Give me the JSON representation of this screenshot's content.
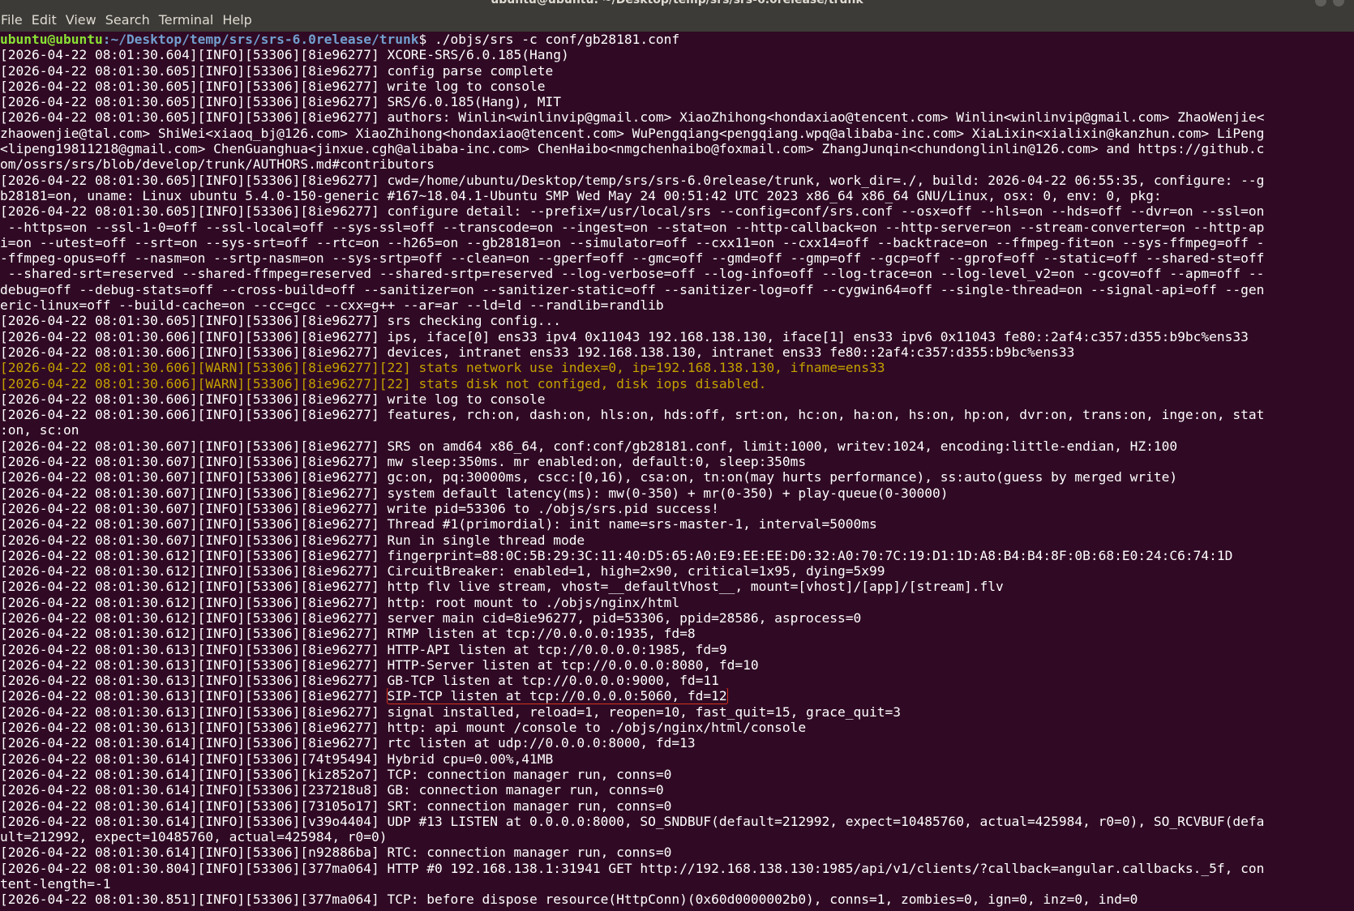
{
  "window": {
    "title": "ubuntu@ubuntu: ~/Desktop/temp/srs/srs-6.0release/trunk"
  },
  "menu": [
    "File",
    "Edit",
    "View",
    "Search",
    "Terminal",
    "Help"
  ],
  "terminal": {
    "prompt_user": "ubuntu@ubuntu",
    "prompt_path": ":~/Desktop/temp/srs/srs-6.0release/trunk",
    "command": "$ ./objs/srs -c conf/gb28181.conf",
    "highlight_text": "SIP-TCP listen at tcp://0.0.0.0:5060, fd=12",
    "colors": {
      "bg": "#300a24",
      "text": "#ffffff",
      "warn": "#c4a000",
      "user": "#8ae234",
      "path": "#729fcf",
      "highlight_box": "#d8321c"
    },
    "lines": [
      {
        "text": "[2026-04-22 08:01:30.604][INFO][53306][8ie96277] XCORE-SRS/6.0.185(Hang)"
      },
      {
        "text": "[2026-04-22 08:01:30.605][INFO][53306][8ie96277] config parse complete"
      },
      {
        "text": "[2026-04-22 08:01:30.605][INFO][53306][8ie96277] write log to console"
      },
      {
        "text": "[2026-04-22 08:01:30.605][INFO][53306][8ie96277] SRS/6.0.185(Hang), MIT"
      },
      {
        "text": "[2026-04-22 08:01:30.605][INFO][53306][8ie96277] authors: Winlin<winlinvip@gmail.com> XiaoZhihong<hondaxiao@tencent.com> Winlin<winlinvip@gmail.com> ZhaoWenjie<"
      },
      {
        "text": "zhaowenjie@tal.com> ShiWei<xiaoq_bj@126.com> XiaoZhihong<hondaxiao@tencent.com> WuPengqiang<pengqiang.wpq@alibaba-inc.com> XiaLixin<xialixin@kanzhun.com> LiPeng"
      },
      {
        "text": "<lipeng19811218@gmail.com> ChenGuanghua<jinxue.cgh@alibaba-inc.com> ChenHaibo<nmgchenhaibo@foxmail.com> ZhangJunqin<chundonglinlin@126.com> and https://github.c"
      },
      {
        "text": "om/ossrs/srs/blob/develop/trunk/AUTHORS.md#contributors"
      },
      {
        "text": "[2026-04-22 08:01:30.605][INFO][53306][8ie96277] cwd=/home/ubuntu/Desktop/temp/srs/srs-6.0release/trunk, work_dir=./, build: 2026-04-22 06:55:35, configure: --g"
      },
      {
        "text": "b28181=on, uname: Linux ubuntu 5.4.0-150-generic #167~18.04.1-Ubuntu SMP Wed May 24 00:51:42 UTC 2023 x86_64 x86_64 GNU/Linux, osx: 0, env: 0, pkg:"
      },
      {
        "text": "[2026-04-22 08:01:30.605][INFO][53306][8ie96277] configure detail: --prefix=/usr/local/srs --config=conf/srs.conf --osx=off --hls=on --hds=off --dvr=on --ssl=on"
      },
      {
        "text": " --https=on --ssl-1-0=off --ssl-local=off --sys-ssl=off --transcode=on --ingest=on --stat=on --http-callback=on --http-server=on --stream-converter=on --http-ap"
      },
      {
        "text": "i=on --utest=off --srt=on --sys-srt=off --rtc=on --h265=on --gb28181=on --simulator=off --cxx11=on --cxx14=off --backtrace=on --ffmpeg-fit=on --sys-ffmpeg=off -"
      },
      {
        "text": "-ffmpeg-opus=off --nasm=on --srtp-nasm=on --sys-srtp=off --clean=on --gperf=off --gmc=off --gmd=off --gmp=off --gcp=off --gprof=off --static=off --shared-st=off"
      },
      {
        "text": " --shared-srt=reserved --shared-ffmpeg=reserved --shared-srtp=reserved --log-verbose=off --log-info=off --log-trace=on --log-level_v2=on --gcov=off --apm=off --"
      },
      {
        "text": "debug=off --debug-stats=off --cross-build=off --sanitizer=on --sanitizer-static=off --sanitizer-log=off --cygwin64=off --single-thread=on --signal-api=off --gen"
      },
      {
        "text": "eric-linux=off --build-cache=on --cc=gcc --cxx=g++ --ar=ar --ld=ld --randlib=randlib"
      },
      {
        "text": "[2026-04-22 08:01:30.605][INFO][53306][8ie96277] srs checking config..."
      },
      {
        "text": "[2026-04-22 08:01:30.606][INFO][53306][8ie96277] ips, iface[0] ens33 ipv4 0x11043 192.168.138.130, iface[1] ens33 ipv6 0x11043 fe80::2af4:c357:d355:b9bc%ens33"
      },
      {
        "text": "[2026-04-22 08:01:30.606][INFO][53306][8ie96277] devices, intranet ens33 192.168.138.130, intranet ens33 fe80::2af4:c357:d355:b9bc%ens33"
      },
      {
        "text": "[2026-04-22 08:01:30.606][WARN][53306][8ie96277][22] stats network use index=0, ip=192.168.138.130, ifname=ens33",
        "warn": true
      },
      {
        "text": "[2026-04-22 08:01:30.606][WARN][53306][8ie96277][22] stats disk not configed, disk iops disabled.",
        "warn": true
      },
      {
        "text": "[2026-04-22 08:01:30.606][INFO][53306][8ie96277] write log to console"
      },
      {
        "text": "[2026-04-22 08:01:30.606][INFO][53306][8ie96277] features, rch:on, dash:on, hls:on, hds:off, srt:on, hc:on, ha:on, hs:on, hp:on, dvr:on, trans:on, inge:on, stat"
      },
      {
        "text": ":on, sc:on"
      },
      {
        "text": "[2026-04-22 08:01:30.607][INFO][53306][8ie96277] SRS on amd64 x86_64, conf:conf/gb28181.conf, limit:1000, writev:1024, encoding:little-endian, HZ:100"
      },
      {
        "text": "[2026-04-22 08:01:30.607][INFO][53306][8ie96277] mw sleep:350ms. mr enabled:on, default:0, sleep:350ms"
      },
      {
        "text": "[2026-04-22 08:01:30.607][INFO][53306][8ie96277] gc:on, pq:30000ms, cscc:[0,16), csa:on, tn:on(may hurts performance), ss:auto(guess by merged write)"
      },
      {
        "text": "[2026-04-22 08:01:30.607][INFO][53306][8ie96277] system default latency(ms): mw(0-350) + mr(0-350) + play-queue(0-30000)"
      },
      {
        "text": "[2026-04-22 08:01:30.607][INFO][53306][8ie96277] write pid=53306 to ./objs/srs.pid success!"
      },
      {
        "text": "[2026-04-22 08:01:30.607][INFO][53306][8ie96277] Thread #1(primordial): init name=srs-master-1, interval=5000ms"
      },
      {
        "text": "[2026-04-22 08:01:30.607][INFO][53306][8ie96277] Run in single thread mode"
      },
      {
        "text": "[2026-04-22 08:01:30.612][INFO][53306][8ie96277] fingerprint=88:0C:5B:29:3C:11:40:D5:65:A0:E9:EE:EE:D0:32:A0:70:7C:19:D1:1D:A8:B4:B4:8F:0B:68:E0:24:C6:74:1D"
      },
      {
        "text": "[2026-04-22 08:01:30.612][INFO][53306][8ie96277] CircuitBreaker: enabled=1, high=2x90, critical=1x95, dying=5x99"
      },
      {
        "text": "[2026-04-22 08:01:30.612][INFO][53306][8ie96277] http flv live stream, vhost=__defaultVhost__, mount=[vhost]/[app]/[stream].flv"
      },
      {
        "text": "[2026-04-22 08:01:30.612][INFO][53306][8ie96277] http: root mount to ./objs/nginx/html"
      },
      {
        "text": "[2026-04-22 08:01:30.612][INFO][53306][8ie96277] server main cid=8ie96277, pid=53306, ppid=28586, asprocess=0"
      },
      {
        "text": "[2026-04-22 08:01:30.612][INFO][53306][8ie96277] RTMP listen at tcp://0.0.0.0:1935, fd=8"
      },
      {
        "text": "[2026-04-22 08:01:30.613][INFO][53306][8ie96277] HTTP-API listen at tcp://0.0.0.0:1985, fd=9"
      },
      {
        "text": "[2026-04-22 08:01:30.613][INFO][53306][8ie96277] HTTP-Server listen at tcp://0.0.0.0:8080, fd=10"
      },
      {
        "text": "[2026-04-22 08:01:30.613][INFO][53306][8ie96277] GB-TCP listen at tcp://0.0.0.0:9000, fd=11"
      },
      {
        "text": "[2026-04-22 08:01:30.613][INFO][53306][8ie96277] ",
        "highlight": true
      },
      {
        "text": "[2026-04-22 08:01:30.613][INFO][53306][8ie96277] signal installed, reload=1, reopen=10, fast_quit=15, grace_quit=3"
      },
      {
        "text": "[2026-04-22 08:01:30.613][INFO][53306][8ie96277] http: api mount /console to ./objs/nginx/html/console"
      },
      {
        "text": "[2026-04-22 08:01:30.614][INFO][53306][8ie96277] rtc listen at udp://0.0.0.0:8000, fd=13"
      },
      {
        "text": "[2026-04-22 08:01:30.614][INFO][53306][74t95494] Hybrid cpu=0.00%,41MB"
      },
      {
        "text": "[2026-04-22 08:01:30.614][INFO][53306][kiz852o7] TCP: connection manager run, conns=0"
      },
      {
        "text": "[2026-04-22 08:01:30.614][INFO][53306][237218u8] GB: connection manager run, conns=0"
      },
      {
        "text": "[2026-04-22 08:01:30.614][INFO][53306][73105o17] SRT: connection manager run, conns=0"
      },
      {
        "text": "[2026-04-22 08:01:30.614][INFO][53306][v39o4404] UDP #13 LISTEN at 0.0.0.0:8000, SO_SNDBUF(default=212992, expect=10485760, actual=425984, r0=0), SO_RCVBUF(defa"
      },
      {
        "text": "ult=212992, expect=10485760, actual=425984, r0=0)"
      },
      {
        "text": "[2026-04-22 08:01:30.614][INFO][53306][n92886ba] RTC: connection manager run, conns=0"
      },
      {
        "text": "[2026-04-22 08:01:30.804][INFO][53306][377ma064] HTTP #0 192.168.138.1:31941 GET http://192.168.138.130:1985/api/v1/clients/?callback=angular.callbacks._5f, con"
      },
      {
        "text": "tent-length=-1"
      },
      {
        "text": "[2026-04-22 08:01:30.851][INFO][53306][377ma064] TCP: before dispose resource(HttpConn)(0x60d0000002b0), conns=1, zombies=0, ign=0, inz=0, ind=0"
      }
    ]
  }
}
